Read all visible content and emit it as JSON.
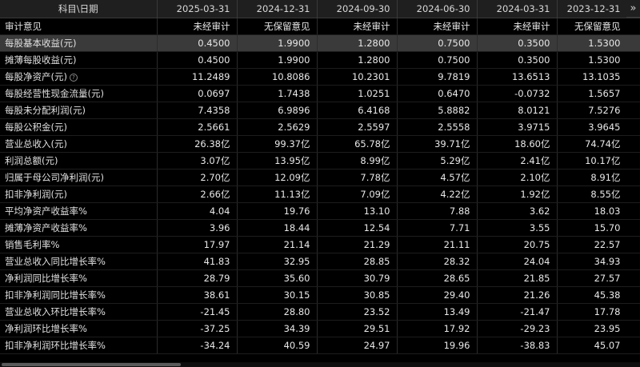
{
  "header": {
    "label_col": "科目\\日期",
    "dates": [
      "2025-03-31",
      "2024-12-31",
      "2024-09-30",
      "2024-06-30",
      "2024-03-31",
      "2023-12-31"
    ],
    "expand_glyph": "»"
  },
  "rows": [
    {
      "label": "审计意见",
      "values": [
        "未经审计",
        "无保留意见",
        "未经审计",
        "未经审计",
        "未经审计",
        "无保留意见"
      ]
    },
    {
      "label": "每股基本收益(元)",
      "values": [
        "0.4500",
        "1.9900",
        "1.2800",
        "0.7500",
        "0.3500",
        "1.5300"
      ]
    },
    {
      "label": "摊薄每股收益(元)",
      "values": [
        "0.4500",
        "1.9900",
        "1.2800",
        "0.7500",
        "0.3500",
        "1.5300"
      ]
    },
    {
      "label": "每股净资产(元)",
      "help_icon": "?",
      "values": [
        "11.2489",
        "10.8086",
        "10.2301",
        "9.7819",
        "13.6513",
        "13.1035"
      ]
    },
    {
      "label": "每股经营性现金流量(元)",
      "values": [
        "0.0697",
        "1.7438",
        "1.0251",
        "0.6470",
        "-0.0732",
        "1.5657"
      ]
    },
    {
      "label": "每股未分配利润(元)",
      "values": [
        "7.4358",
        "6.9896",
        "6.4168",
        "5.8882",
        "8.0121",
        "7.5276"
      ]
    },
    {
      "label": "每股公积金(元)",
      "values": [
        "2.5661",
        "2.5629",
        "2.5597",
        "2.5558",
        "3.9715",
        "3.9645"
      ]
    },
    {
      "label": "营业总收入(元)",
      "values": [
        "26.38亿",
        "99.37亿",
        "65.78亿",
        "39.71亿",
        "18.60亿",
        "74.74亿"
      ]
    },
    {
      "label": "利润总额(元)",
      "values": [
        "3.07亿",
        "13.95亿",
        "8.99亿",
        "5.29亿",
        "2.41亿",
        "10.17亿"
      ]
    },
    {
      "label": "归属于母公司净利润(元)",
      "values": [
        "2.70亿",
        "12.09亿",
        "7.78亿",
        "4.57亿",
        "2.10亿",
        "8.91亿"
      ]
    },
    {
      "label": "扣非净利润(元)",
      "values": [
        "2.66亿",
        "11.13亿",
        "7.09亿",
        "4.22亿",
        "1.92亿",
        "8.55亿"
      ]
    },
    {
      "label": "平均净资产收益率%",
      "values": [
        "4.04",
        "19.76",
        "13.10",
        "7.88",
        "3.62",
        "18.03"
      ]
    },
    {
      "label": "摊薄净资产收益率%",
      "values": [
        "3.96",
        "18.44",
        "12.54",
        "7.71",
        "3.55",
        "15.70"
      ]
    },
    {
      "label": "销售毛利率%",
      "values": [
        "17.97",
        "21.14",
        "21.29",
        "21.11",
        "20.75",
        "22.57"
      ]
    },
    {
      "label": "营业总收入同比增长率%",
      "values": [
        "41.83",
        "32.95",
        "28.85",
        "28.32",
        "24.04",
        "34.93"
      ]
    },
    {
      "label": "净利润同比增长率%",
      "values": [
        "28.79",
        "35.60",
        "30.79",
        "28.65",
        "21.85",
        "27.57"
      ]
    },
    {
      "label": "扣非净利润同比增长率%",
      "values": [
        "38.61",
        "30.15",
        "30.85",
        "29.40",
        "21.26",
        "45.38"
      ]
    },
    {
      "label": "营业总收入环比增长率%",
      "values": [
        "-21.45",
        "28.80",
        "23.52",
        "13.49",
        "-21.47",
        "17.78"
      ]
    },
    {
      "label": "净利润环比增长率%",
      "values": [
        "-37.25",
        "34.39",
        "29.51",
        "17.92",
        "-29.23",
        "23.95"
      ]
    },
    {
      "label": "扣非净利润环比增长率%",
      "values": [
        "-34.24",
        "40.59",
        "24.97",
        "19.96",
        "-38.83",
        "45.07"
      ]
    }
  ],
  "highlighted_row": 1
}
